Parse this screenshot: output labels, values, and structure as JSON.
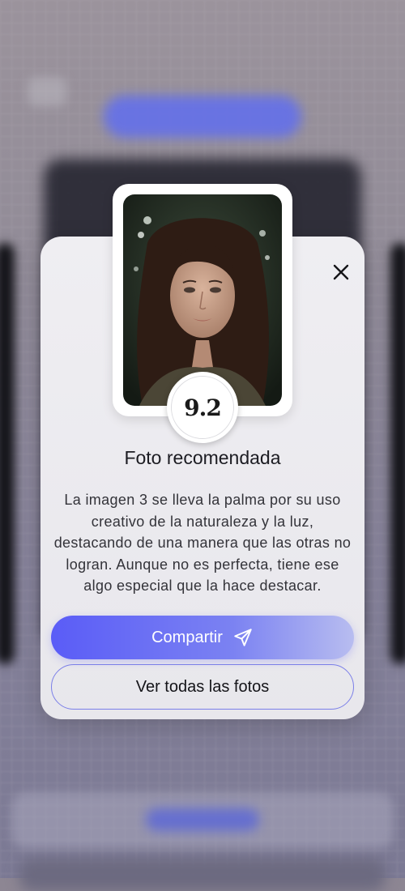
{
  "modal": {
    "score": "9.2",
    "title": "Foto recomendada",
    "description": "La imagen 3 se lleva la palma por su uso creativo de la naturaleza y la luz, destacando de una manera que las otras no logran. Aunque no es perfecta, tiene ese algo especial que la hace destacar.",
    "primary_button": {
      "label": "Compartir",
      "icon": "send-icon"
    },
    "secondary_button": {
      "label": "Ver todas las fotos"
    },
    "close_icon": "close-icon"
  },
  "colors": {
    "accent": "#5a5cf7",
    "accent_light": "#b8bdf0",
    "outline": "#7b7fe8",
    "modal_bg": "#efeef2"
  }
}
